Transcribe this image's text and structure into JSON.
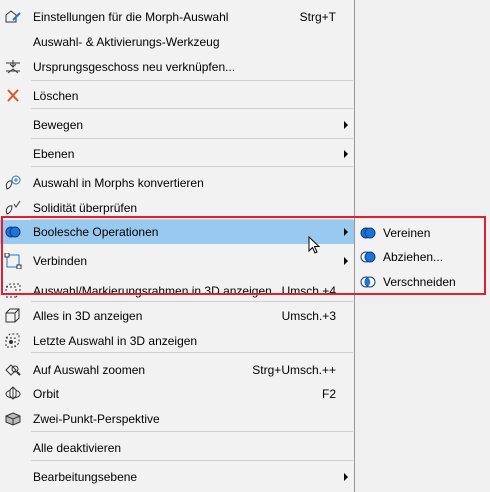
{
  "menu": {
    "items": [
      {
        "label": "Einstellungen für die Morph-Auswahl",
        "shortcut": "Strg+T",
        "icon": "morph-settings-icon"
      },
      {
        "label": "Auswahl- & Aktivierungs-Werkzeug",
        "shortcut": "",
        "icon": ""
      },
      {
        "label": "Ursprungsgeschoss neu verknüpfen...",
        "shortcut": "",
        "icon": "story-relink-icon"
      },
      {
        "label": "Löschen",
        "shortcut": "",
        "icon": "delete-x-icon"
      },
      {
        "label": "Bewegen",
        "shortcut": "",
        "icon": "",
        "submenu": true
      },
      {
        "label": "Ebenen",
        "shortcut": "",
        "icon": "",
        "submenu": true
      },
      {
        "label": "Auswahl in Morphs konvertieren",
        "shortcut": "",
        "icon": "convert-morph-icon"
      },
      {
        "label": "Solidität überprüfen",
        "shortcut": "",
        "icon": "check-solidity-icon"
      },
      {
        "label": "Boolesche Operationen",
        "shortcut": "",
        "icon": "boolean-ops-icon",
        "submenu": true,
        "highlighted": true
      },
      {
        "label": "Verbinden",
        "shortcut": "",
        "icon": "connect-icon",
        "submenu": true
      },
      {
        "label": "Auswahl/Markierungsrahmen in 3D anzeigen",
        "shortcut": "Umsch.+4",
        "icon": "marquee-3d-icon"
      },
      {
        "label": "Alles in 3D anzeigen",
        "shortcut": "Umsch.+3",
        "icon": "all-3d-icon"
      },
      {
        "label": "Letzte Auswahl in 3D anzeigen",
        "shortcut": "",
        "icon": "last-selection-3d-icon"
      },
      {
        "label": "Auf Auswahl zoomen",
        "shortcut": "Strg+Umsch.++",
        "icon": "zoom-selection-icon"
      },
      {
        "label": "Orbit",
        "shortcut": "F2",
        "icon": "orbit-icon"
      },
      {
        "label": "Zwei-Punkt-Perspektive",
        "shortcut": "",
        "icon": "two-point-perspective-icon"
      },
      {
        "label": "Alle deaktivieren",
        "shortcut": "",
        "icon": ""
      },
      {
        "label": "Bearbeitungsebene",
        "shortcut": "",
        "icon": "",
        "submenu": true
      }
    ]
  },
  "submenu": {
    "items": [
      {
        "label": "Vereinen",
        "icon": "union-icon"
      },
      {
        "label": "Abziehen...",
        "icon": "subtract-icon"
      },
      {
        "label": "Verschneiden",
        "icon": "intersect-icon"
      }
    ]
  },
  "colors": {
    "highlight": "#99c9ef",
    "callout": "#e0202e",
    "accent": "#1e73d8"
  }
}
